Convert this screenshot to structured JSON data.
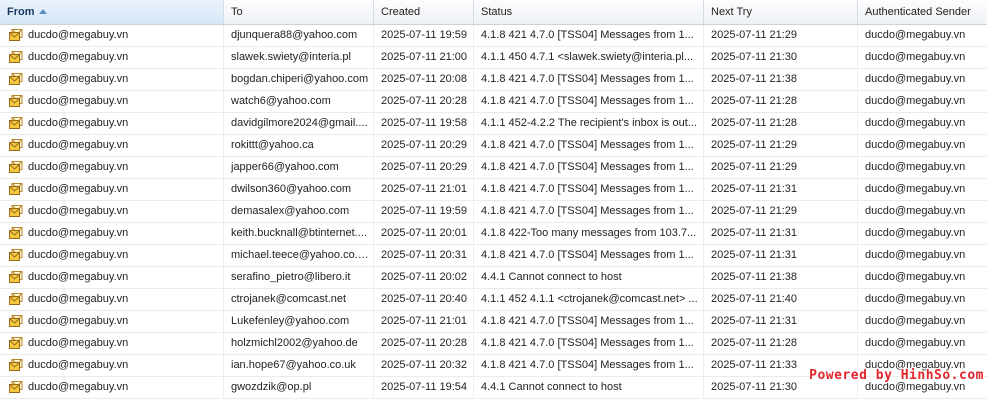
{
  "columns": {
    "from": "From",
    "to": "To",
    "created": "Created",
    "status": "Status",
    "next_try": "Next Try",
    "auth_sender": "Authenticated Sender"
  },
  "sort": {
    "column": "from",
    "direction": "ascending"
  },
  "rows": [
    {
      "from": "ducdo@megabuy.vn",
      "to": "djunquera88@yahoo.com",
      "created": "2025-07-11 19:59",
      "status": "4.1.8 421 4.7.0 [TSS04] Messages from 1...",
      "next_try": "2025-07-11 21:29",
      "auth": "ducdo@megabuy.vn"
    },
    {
      "from": "ducdo@megabuy.vn",
      "to": "slawek.swiety@interia.pl",
      "created": "2025-07-11 21:00",
      "status": "4.1.1 450 4.7.1 <slawek.swiety@interia.pl...",
      "next_try": "2025-07-11 21:30",
      "auth": "ducdo@megabuy.vn"
    },
    {
      "from": "ducdo@megabuy.vn",
      "to": "bogdan.chiperi@yahoo.com",
      "created": "2025-07-11 20:08",
      "status": "4.1.8 421 4.7.0 [TSS04] Messages from 1...",
      "next_try": "2025-07-11 21:38",
      "auth": "ducdo@megabuy.vn"
    },
    {
      "from": "ducdo@megabuy.vn",
      "to": "watch6@yahoo.com",
      "created": "2025-07-11 20:28",
      "status": "4.1.8 421 4.7.0 [TSS04] Messages from 1...",
      "next_try": "2025-07-11 21:28",
      "auth": "ducdo@megabuy.vn"
    },
    {
      "from": "ducdo@megabuy.vn",
      "to": "davidgilmore2024@gmail....",
      "created": "2025-07-11 19:58",
      "status": "4.1.1 452-4.2.2 The recipient's inbox is out...",
      "next_try": "2025-07-11 21:28",
      "auth": "ducdo@megabuy.vn"
    },
    {
      "from": "ducdo@megabuy.vn",
      "to": "rokittt@yahoo.ca",
      "created": "2025-07-11 20:29",
      "status": "4.1.8 421 4.7.0 [TSS04] Messages from 1...",
      "next_try": "2025-07-11 21:29",
      "auth": "ducdo@megabuy.vn"
    },
    {
      "from": "ducdo@megabuy.vn",
      "to": "japper66@yahoo.com",
      "created": "2025-07-11 20:29",
      "status": "4.1.8 421 4.7.0 [TSS04] Messages from 1...",
      "next_try": "2025-07-11 21:29",
      "auth": "ducdo@megabuy.vn"
    },
    {
      "from": "ducdo@megabuy.vn",
      "to": "dwilson360@yahoo.com",
      "created": "2025-07-11 21:01",
      "status": "4.1.8 421 4.7.0 [TSS04] Messages from 1...",
      "next_try": "2025-07-11 21:31",
      "auth": "ducdo@megabuy.vn"
    },
    {
      "from": "ducdo@megabuy.vn",
      "to": "demasalex@yahoo.com",
      "created": "2025-07-11 19:59",
      "status": "4.1.8 421 4.7.0 [TSS04] Messages from 1...",
      "next_try": "2025-07-11 21:29",
      "auth": "ducdo@megabuy.vn"
    },
    {
      "from": "ducdo@megabuy.vn",
      "to": "keith.bucknall@btinternet....",
      "created": "2025-07-11 20:01",
      "status": "4.1.8 422-Too many messages from 103.7...",
      "next_try": "2025-07-11 21:31",
      "auth": "ducdo@megabuy.vn"
    },
    {
      "from": "ducdo@megabuy.vn",
      "to": "michael.teece@yahoo.co.nz",
      "created": "2025-07-11 20:31",
      "status": "4.1.8 421 4.7.0 [TSS04] Messages from 1...",
      "next_try": "2025-07-11 21:31",
      "auth": "ducdo@megabuy.vn"
    },
    {
      "from": "ducdo@megabuy.vn",
      "to": "serafino_pietro@libero.it",
      "created": "2025-07-11 20:02",
      "status": "4.4.1 Cannot connect to host",
      "next_try": "2025-07-11 21:38",
      "auth": "ducdo@megabuy.vn"
    },
    {
      "from": "ducdo@megabuy.vn",
      "to": "ctrojanek@comcast.net",
      "created": "2025-07-11 20:40",
      "status": "4.1.1 452 4.1.1 <ctrojanek@comcast.net> ...",
      "next_try": "2025-07-11 21:40",
      "auth": "ducdo@megabuy.vn"
    },
    {
      "from": "ducdo@megabuy.vn",
      "to": "Lukefenley@yahoo.com",
      "created": "2025-07-11 21:01",
      "status": "4.1.8 421 4.7.0 [TSS04] Messages from 1...",
      "next_try": "2025-07-11 21:31",
      "auth": "ducdo@megabuy.vn"
    },
    {
      "from": "ducdo@megabuy.vn",
      "to": "holzmichl2002@yahoo.de",
      "created": "2025-07-11 20:28",
      "status": "4.1.8 421 4.7.0 [TSS04] Messages from 1...",
      "next_try": "2025-07-11 21:28",
      "auth": "ducdo@megabuy.vn"
    },
    {
      "from": "ducdo@megabuy.vn",
      "to": "ian.hope67@yahoo.co.uk",
      "created": "2025-07-11 20:32",
      "status": "4.1.8 421 4.7.0 [TSS04] Messages from 1...",
      "next_try": "2025-07-11 21:33",
      "auth": "ducdo@megabuy.vn"
    },
    {
      "from": "ducdo@megabuy.vn",
      "to": "gwozdzik@op.pl",
      "created": "2025-07-11 19:54",
      "status": "4.4.1 Cannot connect to host",
      "next_try": "2025-07-11 21:30",
      "auth": "ducdo@megabuy.vn"
    }
  ],
  "row_icon": "envelope-icon",
  "watermark": "Powered by HinhSo.com"
}
